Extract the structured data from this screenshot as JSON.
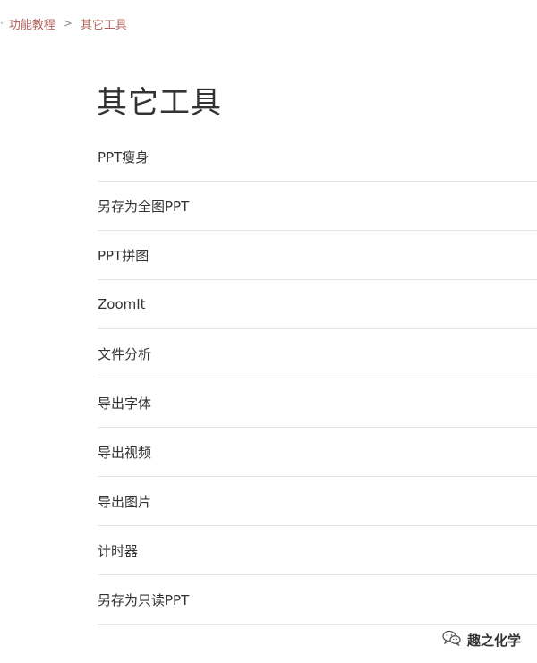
{
  "breadcrumb": {
    "lead_separator": "·",
    "items": [
      {
        "label": "功能教程"
      },
      {
        "label": "其它工具"
      }
    ],
    "separator": ">"
  },
  "page": {
    "title": "其它工具"
  },
  "list": {
    "items": [
      {
        "label": "PPT瘦身"
      },
      {
        "label": "另存为全图PPT"
      },
      {
        "label": "PPT拼图"
      },
      {
        "label": "ZoomIt"
      },
      {
        "label": "文件分析"
      },
      {
        "label": "导出字体"
      },
      {
        "label": "导出视频"
      },
      {
        "label": "导出图片"
      },
      {
        "label": "计时器"
      },
      {
        "label": "另存为只读PPT"
      }
    ]
  },
  "watermark": {
    "icon": "wechat-icon",
    "text": "趣之化学"
  },
  "colors": {
    "breadcrumb_link": "#b5635a",
    "text": "#333333",
    "divider": "#e5e5e5"
  }
}
